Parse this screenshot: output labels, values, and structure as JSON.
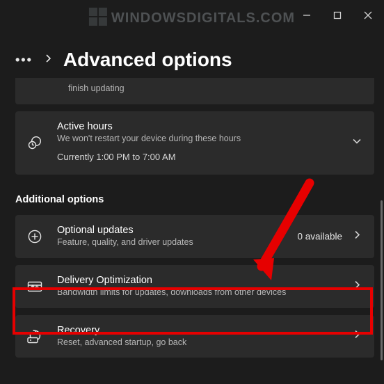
{
  "watermark": "WINDOWSDIGITALS.COM",
  "page_title": "Advanced options",
  "truncated_card_sub": "finish updating",
  "active_hours": {
    "title": "Active hours",
    "subtitle": "We won't restart your device during these hours",
    "current": "Currently 1:00 PM to 7:00 AM"
  },
  "section_header": "Additional options",
  "optional_updates": {
    "title": "Optional updates",
    "subtitle": "Feature, quality, and driver updates",
    "count": "0 available"
  },
  "delivery_opt": {
    "title": "Delivery Optimization",
    "subtitle": "Bandwidth limits for updates, downloads from other devices"
  },
  "recovery": {
    "title": "Recovery",
    "subtitle": "Reset, advanced startup, go back"
  }
}
